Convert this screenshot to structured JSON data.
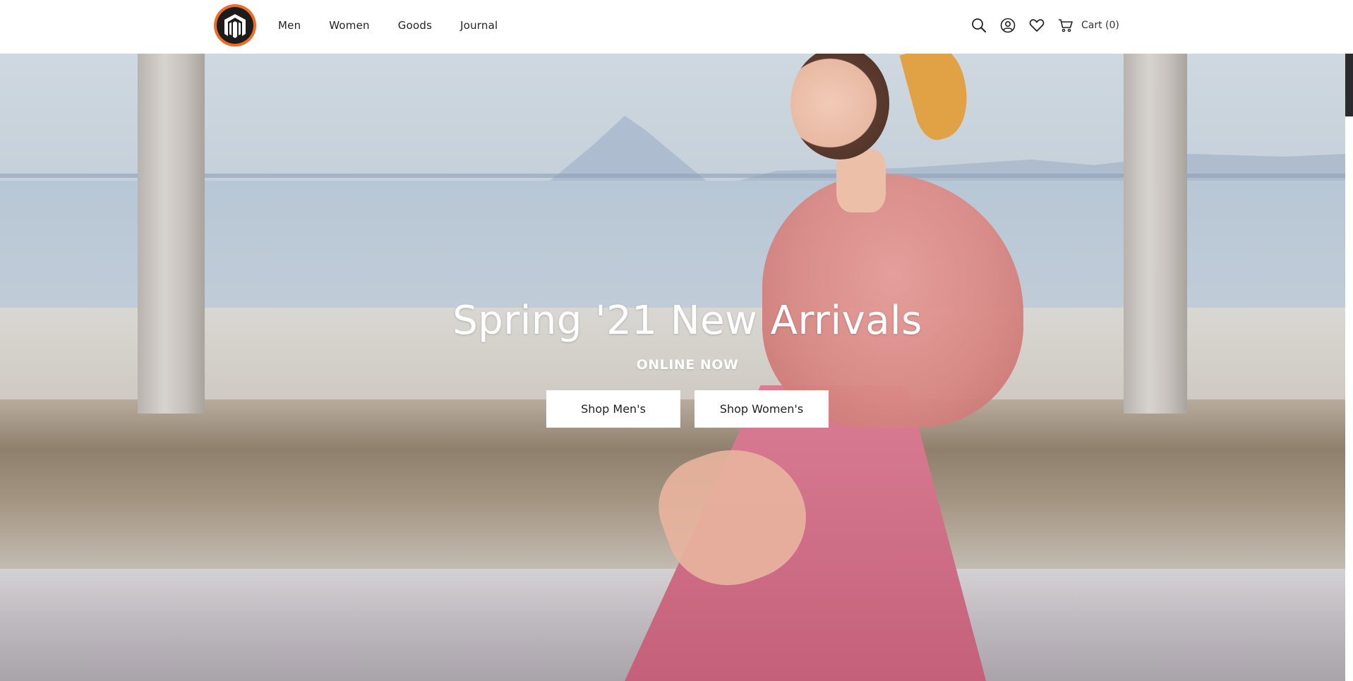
{
  "header": {
    "logo_name": "magento-logo",
    "nav": [
      {
        "label": "Men"
      },
      {
        "label": "Women"
      },
      {
        "label": "Goods"
      },
      {
        "label": "Journal"
      }
    ],
    "cart_label": "Cart (0)",
    "icons": [
      "search-icon",
      "account-icon",
      "wishlist-heart-icon",
      "cart-icon"
    ]
  },
  "hero": {
    "title": "Spring '21 New Arrivals",
    "subtitle": "ONLINE NOW",
    "buttons": [
      {
        "label": "Shop Men's"
      },
      {
        "label": "Shop Women's"
      }
    ]
  },
  "colors": {
    "logo_orange": "#f26b22",
    "logo_dark": "#1c1c1c",
    "button_bg": "#ffffff",
    "text_dark": "#222222"
  }
}
